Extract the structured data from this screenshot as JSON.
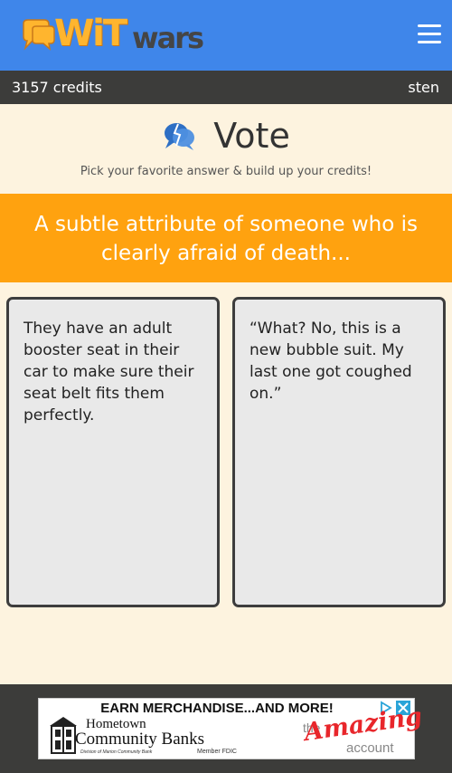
{
  "header": {
    "logo_wit": "WiT",
    "logo_wars": "wars",
    "menu_icon": "hamburger-icon",
    "bg_color": "#3f86ea"
  },
  "status": {
    "credits": "3157 credits",
    "username": "sten"
  },
  "vote": {
    "title": "Vote",
    "icon": "speech-bubbles-icon",
    "subtitle": "Pick your favorite answer & build up your credits!"
  },
  "prompt": {
    "text": "A subtle attribute of someone who is clearly afraid of death...",
    "bg_color": "#ffa20f"
  },
  "answers": [
    {
      "text": "They have an adult booster seat in their car to make sure their seat belt fits them perfectly."
    },
    {
      "text": "“What? No, this is a new bubble suit. My last one got coughed on.”"
    }
  ],
  "ad": {
    "headline": "EARN MERCHANDISE...AND MORE!",
    "brand_line1": "Hometown",
    "brand_line2": "Community Banks",
    "small_print": "Division of Marion Community Bank",
    "fdic": "Member FDIC",
    "tagline_the": "the",
    "tagline_amazing": "Amazing",
    "tagline_account": "account",
    "adchoices_icon": "adchoices-icon",
    "close_icon": "close-icon",
    "accent_color": "#e8262b"
  }
}
